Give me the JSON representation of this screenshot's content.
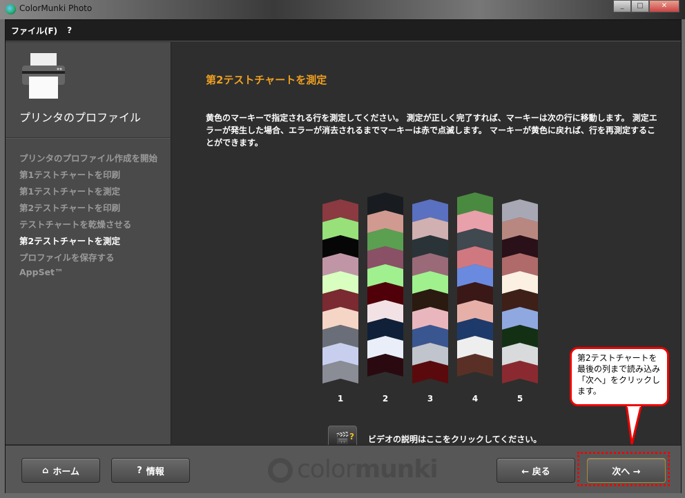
{
  "window": {
    "title": "ColorMunki Photo",
    "controls": [
      "_",
      "□",
      "✕"
    ]
  },
  "menu": [
    "ファイル(F)",
    "?"
  ],
  "sidebar": {
    "title": "プリンタのプロファイル",
    "steps": [
      "プリンタのプロファイル作成を開始",
      "第1テストチャートを印刷",
      "第1テストチャートを測定",
      "第2テストチャートを印刷",
      "テストチャートを乾燥させる",
      "第2テストチャートを測定",
      "プロファイルを保存する",
      "AppSet™"
    ],
    "active_step": 5
  },
  "main": {
    "heading": "第2テストチャートを測定",
    "instructions": "黄色のマーキーで指定される行を測定してください。 測定が正しく完了すれば、マーキーは次の行に移動します。 測定エラーが発生した場合、エラーが消去されるまでマーキーは赤で点滅します。 マーキーが黄色に戻れば、行を再測定することができます。",
    "video_text": "ビデオの説明はここをクリックしてください。",
    "video_icon": "clapperboard-question-icon"
  },
  "chart": {
    "strips": [
      {
        "label": "1",
        "colors": [
          "#8a3a40",
          "#98e07a",
          "#060606",
          "#c096a6",
          "#d8ffc0",
          "#7a2a30",
          "#f5d5c5",
          "#6a6e78",
          "#c8cfee",
          "#8a8c96"
        ]
      },
      {
        "label": "2",
        "colors": [
          "#181c20",
          "#d09a90",
          "#5aa050",
          "#8a5066",
          "#a0f090",
          "#500008",
          "#f2e2e6",
          "#102038",
          "#eaeef8",
          "#2a0a10"
        ]
      },
      {
        "label": "3",
        "colors": [
          "#5a70c0",
          "#d0b0b0",
          "#2a3438",
          "#9a6a78",
          "#a0f08e",
          "#2a1a10",
          "#eab6be",
          "#3a5690",
          "#c0c4cc",
          "#5a0a0c"
        ]
      },
      {
        "label": "4",
        "colors": [
          "#4a8a40",
          "#e8a0aa",
          "#404850",
          "#d07880",
          "#6a8ae0",
          "#3a1818",
          "#e6b0a8",
          "#1e3a6a",
          "#eeeeee",
          "#5a3026"
        ]
      },
      {
        "label": "5",
        "colors": [
          "#a8a8b4",
          "#b88880",
          "#2a1018",
          "#b06a6a",
          "#fbf0e2",
          "#3e2018",
          "#90a8e0",
          "#143014",
          "#d8dadc",
          "#8a2a30"
        ]
      }
    ]
  },
  "footer": {
    "home": "ホーム",
    "info": "情報",
    "back": "← 戻る",
    "next": "次へ →",
    "logo_a": "color",
    "logo_b": "munki"
  },
  "callout": "第2テストチャートを最後の列まで読み込み「次へ」をクリックします。",
  "colors": {
    "accent": "#f0a020",
    "callout_border": "#e00000"
  }
}
